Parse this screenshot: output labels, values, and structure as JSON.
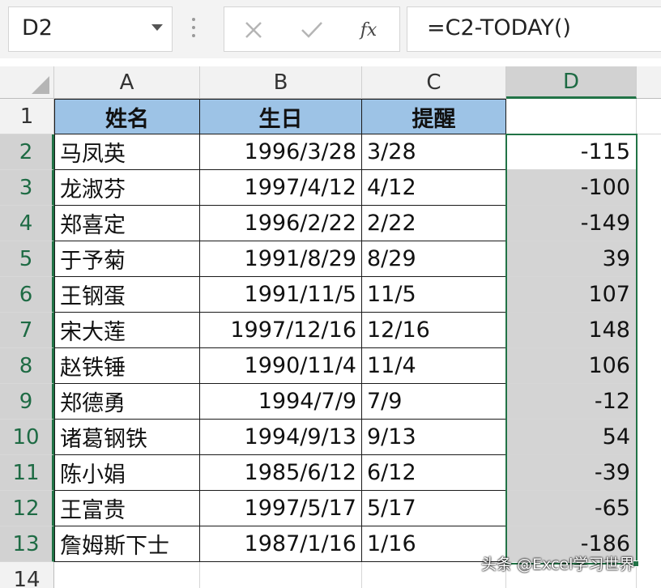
{
  "formula_bar": {
    "name_box": "D2",
    "formula": "=C2-TODAY()",
    "fx_label": "fx"
  },
  "columns": [
    "A",
    "B",
    "C",
    "D"
  ],
  "rows": [
    "1",
    "2",
    "3",
    "4",
    "5",
    "6",
    "7",
    "8",
    "9",
    "10",
    "11",
    "12",
    "13",
    "14"
  ],
  "headers": {
    "name": "姓名",
    "birthday": "生日",
    "reminder": "提醒"
  },
  "records": [
    {
      "name": "马凤英",
      "birthday": "1996/3/28",
      "reminder": "3/28",
      "d": "-115"
    },
    {
      "name": "龙淑芬",
      "birthday": "1997/4/12",
      "reminder": "4/12",
      "d": "-100"
    },
    {
      "name": "郑喜定",
      "birthday": "1996/2/22",
      "reminder": "2/22",
      "d": "-149"
    },
    {
      "name": "于予菊",
      "birthday": "1991/8/29",
      "reminder": "8/29",
      "d": "39"
    },
    {
      "name": "王钢蛋",
      "birthday": "1991/11/5",
      "reminder": "11/5",
      "d": "107"
    },
    {
      "name": "宋大莲",
      "birthday": "1997/12/16",
      "reminder": "12/16",
      "d": "148"
    },
    {
      "name": "赵铁锤",
      "birthday": "1990/11/4",
      "reminder": "11/4",
      "d": "106"
    },
    {
      "name": "郑德勇",
      "birthday": "1994/7/9",
      "reminder": "7/9",
      "d": "-12"
    },
    {
      "name": "诸葛钢铁",
      "birthday": "1994/9/13",
      "reminder": "9/13",
      "d": "54"
    },
    {
      "name": "陈小娟",
      "birthday": "1985/6/12",
      "reminder": "6/12",
      "d": "-39"
    },
    {
      "name": "王富贵",
      "birthday": "1997/5/17",
      "reminder": "5/17",
      "d": "-65"
    },
    {
      "name": "詹姆斯下士",
      "birthday": "1987/1/16",
      "reminder": "1/16",
      "d": "-186"
    }
  ],
  "watermark": "头条 @Excel学习世界",
  "colors": {
    "header_fill": "#9dc3e6",
    "selection": "#217346",
    "selected_fill": "#d4d4d4"
  }
}
